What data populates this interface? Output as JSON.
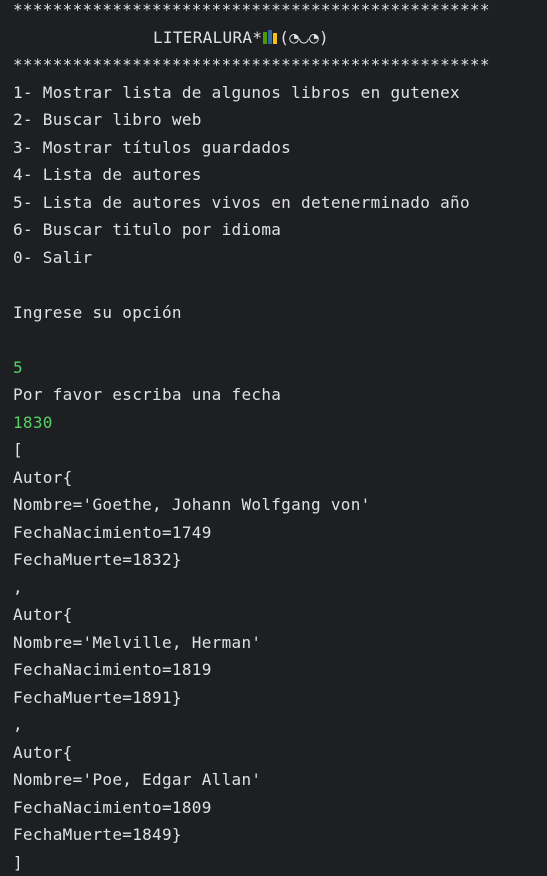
{
  "console": {
    "header": {
      "border_top": "************************************************",
      "title_text": "LITERALURA*",
      "book_icon": "books-icon",
      "kaomoji": "(◔◡◔)",
      "border_bottom": "************************************************"
    },
    "menu_items": [
      "1- Mostrar lista de algunos libros en gutenex",
      "2- Buscar libro web",
      "3- Mostrar títulos guardados",
      "4- Lista de autores",
      "5- Lista de autores vivos en detenerminado año",
      "6- Buscar titulo por idioma",
      "0- Salir"
    ],
    "prompt": "Ingrese su opción",
    "user_option": "5",
    "date_prompt": "Por favor escriba una fecha",
    "user_date": "1830",
    "open_bracket": "[",
    "authors": [
      {
        "open": "Autor{",
        "nombre": "Nombre='Goethe, Johann Wolfgang von'",
        "nacimiento": "FechaNacimiento=1749",
        "muerte": "FechaMuerte=1832}"
      },
      {
        "open": "Autor{",
        "nombre": "Nombre='Melville, Herman'",
        "nacimiento": "FechaNacimiento=1819",
        "muerte": "FechaMuerte=1891}"
      },
      {
        "open": "Autor{",
        "nombre": "Nombre='Poe, Edgar Allan'",
        "nacimiento": "FechaNacimiento=1809",
        "muerte": "FechaMuerte=1849}"
      }
    ],
    "separator": ",",
    "close_bracket": "]"
  },
  "colors": {
    "background": "#1e1f22",
    "text": "#dfe1e5",
    "input_text": "#56d364"
  }
}
